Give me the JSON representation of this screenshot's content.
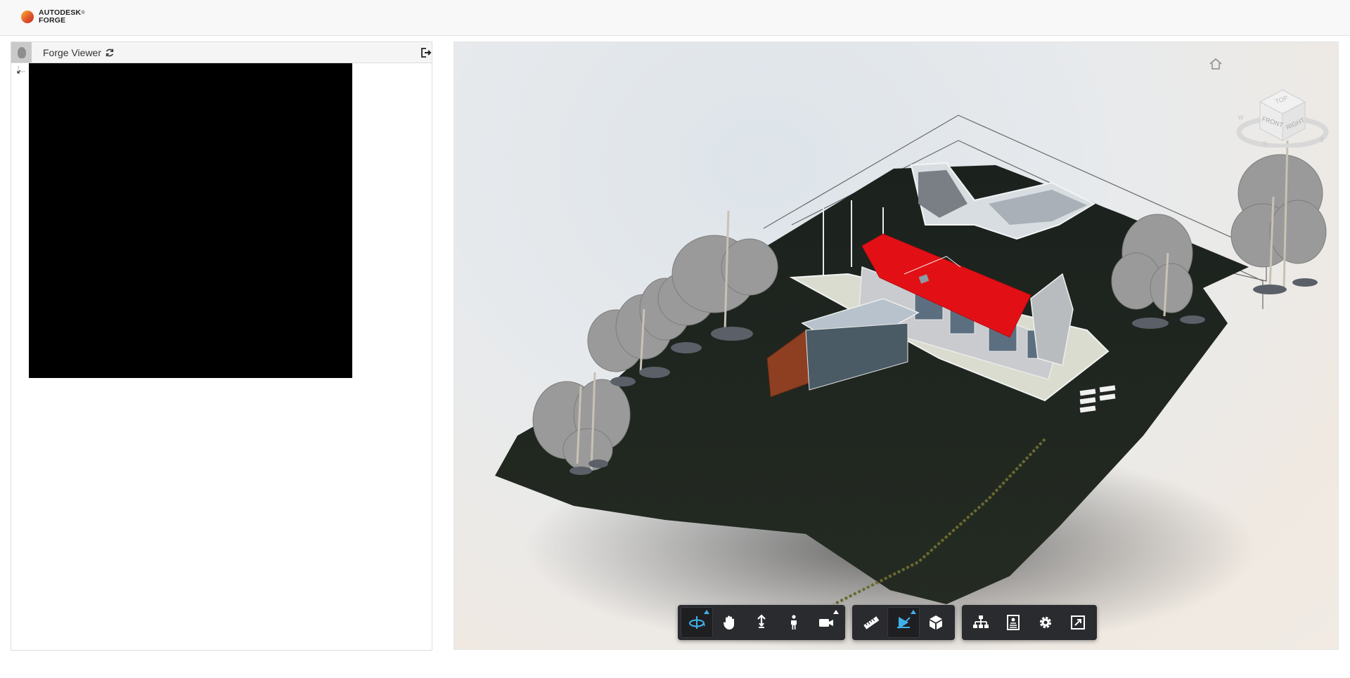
{
  "header": {
    "brand_line1": "AUTODESK",
    "brand_mark": "®",
    "brand_line2": "FORGE"
  },
  "left_panel": {
    "title": "Forge Viewer",
    "avatar_icon": "user-avatar-icon",
    "refresh_icon": "refresh-icon",
    "logout_icon": "logout-icon"
  },
  "viewer": {
    "home_icon": "home-icon",
    "viewcube": {
      "top": "TOP",
      "front": "FRONT",
      "right": "RIGHT",
      "compass": [
        "W",
        "S",
        "E"
      ]
    },
    "toolbar": {
      "groups": [
        {
          "name": "navigation",
          "tools": [
            "orbit",
            "pan",
            "dolly",
            "first-person",
            "camera"
          ]
        },
        {
          "name": "modeling",
          "tools": [
            "measure",
            "section",
            "explode"
          ]
        },
        {
          "name": "settings",
          "tools": [
            "model-browser",
            "properties",
            "settings",
            "fullscreen"
          ]
        }
      ],
      "active_tools": [
        "orbit",
        "section"
      ],
      "accent_color": "#3fb1ea"
    },
    "colors": {
      "roof": "#e21015",
      "terrain": "#1d2320",
      "cladding": "#8e3f22",
      "trees": "#9a9a9a"
    }
  }
}
